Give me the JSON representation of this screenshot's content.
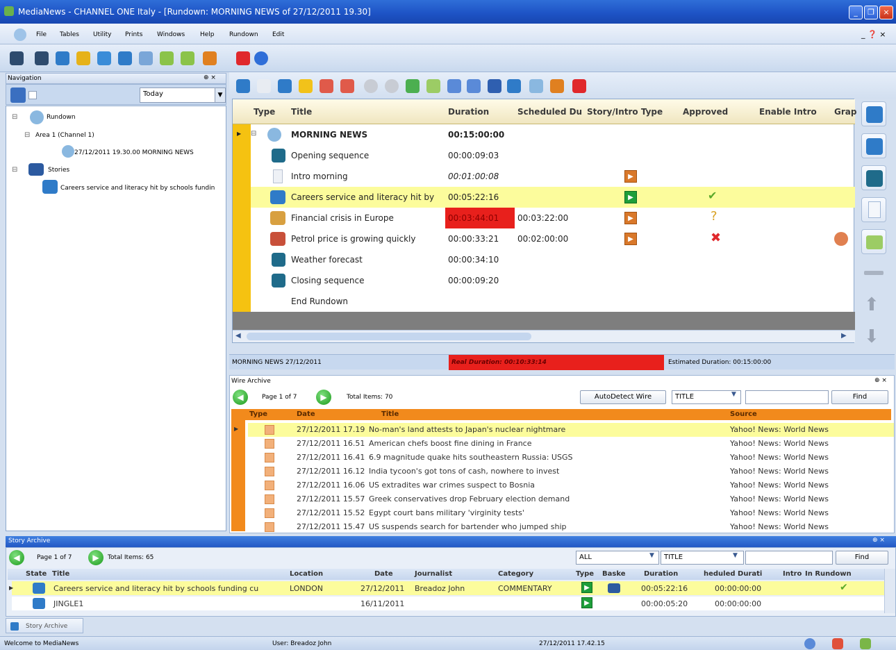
{
  "window": {
    "title": "MediaNews - CHANNEL ONE Italy - [Rundown: MORNING NEWS of 27/12/2011 19.30]"
  },
  "menu": {
    "items": [
      "File",
      "Tables",
      "Utility",
      "Prints",
      "Windows",
      "Help",
      "Rundown",
      "Edit"
    ],
    "right": "_ ❓ ×"
  },
  "navigation": {
    "title": "Navigation",
    "filter_value": "Today",
    "tree": {
      "rundown": "Rundown",
      "area": "Area 1 (Channel 1)",
      "rundown_item": "27/12/2011 19.30.00 MORNING NEWS",
      "stories": "Stories",
      "story_item": "Careers service and literacy hit by schools fundin"
    }
  },
  "rundown_grid": {
    "headers": {
      "type": "Type",
      "title": "Title",
      "duration": "Duration",
      "scheduled": "Scheduled Du",
      "story_intro": "Story/Intro Type",
      "approved": "Approved",
      "enable_intro": "Enable Intro",
      "graph": "Grap"
    },
    "rows": [
      {
        "title": "MORNING NEWS",
        "duration": "00:15:00:00",
        "scheduled": ""
      },
      {
        "title": "Opening sequence",
        "duration": "00:00:09:03",
        "scheduled": ""
      },
      {
        "title": "Intro morning",
        "duration": "00:01:00:08",
        "scheduled": ""
      },
      {
        "title": "Careers service and literacy hit by",
        "duration": "00:05:22:16",
        "scheduled": ""
      },
      {
        "title": "Financial crisis in Europe",
        "duration": "00:03:44:01",
        "scheduled": "00:03:22:00"
      },
      {
        "title": "Petrol price is growing quickly",
        "duration": "00:00:33:21",
        "scheduled": "00:02:00:00"
      },
      {
        "title": "Weather forecast",
        "duration": "00:00:34:10",
        "scheduled": ""
      },
      {
        "title": "Closing sequence",
        "duration": "00:00:09:20",
        "scheduled": ""
      },
      {
        "title": "End Rundown",
        "duration": "",
        "scheduled": ""
      }
    ]
  },
  "rundown_status": {
    "name": "MORNING NEWS 27/12/2011",
    "real_duration": "Real Duration: 00:10:33:14",
    "estimated": "Estimated Duration: 00:15:00:00"
  },
  "wire_archive": {
    "title": "Wire Archive",
    "page": "Page 1 of 7",
    "total": "Total Items: 70",
    "autodetect_label": "AutoDetect Wire",
    "field_value": "TITLE",
    "find_label": "Find",
    "headers": {
      "type": "Type",
      "date": "Date",
      "title": "Title",
      "source": "Source"
    },
    "rows": [
      {
        "date": "27/12/2011 17.19",
        "title": "No-man's land attests to Japan's nuclear nightmare",
        "source": "Yahoo! News: World News"
      },
      {
        "date": "27/12/2011 16.51",
        "title": "American chefs boost fine dining in France",
        "source": "Yahoo! News: World News"
      },
      {
        "date": "27/12/2011 16.41",
        "title": "6.9 magnitude quake hits southeastern Russia: USGS",
        "source": "Yahoo! News: World News"
      },
      {
        "date": "27/12/2011 16.12",
        "title": "India tycoon's got tons of cash, nowhere to invest",
        "source": "Yahoo! News: World News"
      },
      {
        "date": "27/12/2011 16.06",
        "title": "US extradites war crimes suspect to Bosnia",
        "source": "Yahoo! News: World News"
      },
      {
        "date": "27/12/2011 15.57",
        "title": "Greek conservatives drop February election demand",
        "source": "Yahoo! News: World News"
      },
      {
        "date": "27/12/2011 15.52",
        "title": "Egypt court bans military 'virginity tests'",
        "source": "Yahoo! News: World News"
      },
      {
        "date": "27/12/2011 15.47",
        "title": "US suspends search for bartender who jumped ship",
        "source": "Yahoo! News: World News"
      }
    ]
  },
  "story_archive": {
    "title": "Story Archive",
    "page": "Page 1 of 7",
    "total": "Total Items: 65",
    "filter_value": "ALL",
    "field_value": "TITLE",
    "find_label": "Find",
    "tab_label": "Story Archive",
    "headers": {
      "state": "State",
      "title": "Title",
      "location": "Location",
      "date": "Date",
      "journalist": "Journalist",
      "category": "Category",
      "type": "Type",
      "basket": "Baske",
      "duration": "Duration",
      "scheduled": "heduled Durati",
      "intro": "Intro",
      "in_rundown": "In Rundown"
    },
    "rows": [
      {
        "title": "Careers service and literacy hit by schools funding cu",
        "location": "LONDON",
        "date": "27/12/2011",
        "journalist": "Breadoz John",
        "category": "COMMENTARY",
        "duration": "00:05:22:16",
        "scheduled": "00:00:00:00"
      },
      {
        "title": "JINGLE1",
        "location": "",
        "date": "16/11/2011",
        "journalist": "",
        "category": "",
        "duration": "00:00:05:20",
        "scheduled": "00:00:00:00"
      }
    ]
  },
  "statusbar": {
    "welcome": "Welcome to MediaNews",
    "user": "User: Breadoz John",
    "datetime": "27/12/2011 17.42.15"
  },
  "colors": {
    "selected_row": "#fcfc9c",
    "duration_alert": "#e8201c",
    "wire_header": "#f28a1c",
    "title_bar": "#1d52c4"
  }
}
